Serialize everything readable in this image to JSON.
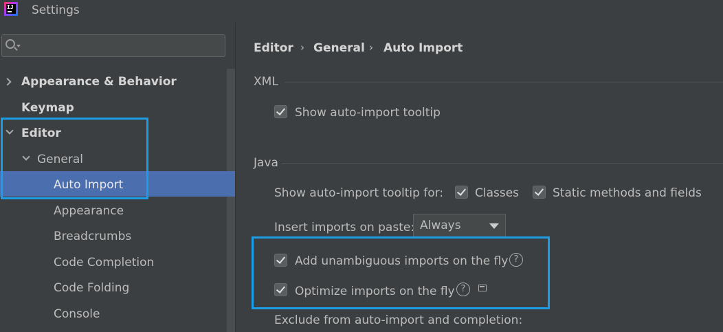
{
  "window": {
    "title": "Settings",
    "logo_text": "IJ"
  },
  "search": {
    "placeholder": ""
  },
  "sidebar": {
    "items": [
      {
        "label": "Appearance & Behavior"
      },
      {
        "label": "Keymap"
      },
      {
        "label": "Editor"
      },
      {
        "label": "General"
      },
      {
        "label": "Auto Import"
      },
      {
        "label": "Appearance"
      },
      {
        "label": "Breadcrumbs"
      },
      {
        "label": "Code Completion"
      },
      {
        "label": "Code Folding"
      },
      {
        "label": "Console"
      }
    ]
  },
  "breadcrumb": [
    "Editor",
    "General",
    "Auto Import"
  ],
  "breadcrumb_sep": "›",
  "xml": {
    "title": "XML",
    "show_tooltip": {
      "label": "Show auto-import tooltip",
      "checked": true
    }
  },
  "java": {
    "title": "Java",
    "tooltip_for_label": "Show auto-import tooltip for:",
    "classes": {
      "label": "Classes",
      "checked": true
    },
    "static_methods": {
      "label": "Static methods and fields",
      "checked": true
    },
    "insert_on_paste_label": "Insert imports on paste:",
    "insert_on_paste_value": "Always",
    "add_unambiguous": {
      "label": "Add unambiguous imports on the fly",
      "checked": true
    },
    "optimize_imports": {
      "label": "Optimize imports on the fly",
      "checked": true
    },
    "exclude_label": "Exclude from auto-import and completion:"
  },
  "help_glyph": "?",
  "colors": {
    "selection": "#4b6eaf",
    "highlight": "#1c9ee6",
    "background": "#3c3f41"
  }
}
